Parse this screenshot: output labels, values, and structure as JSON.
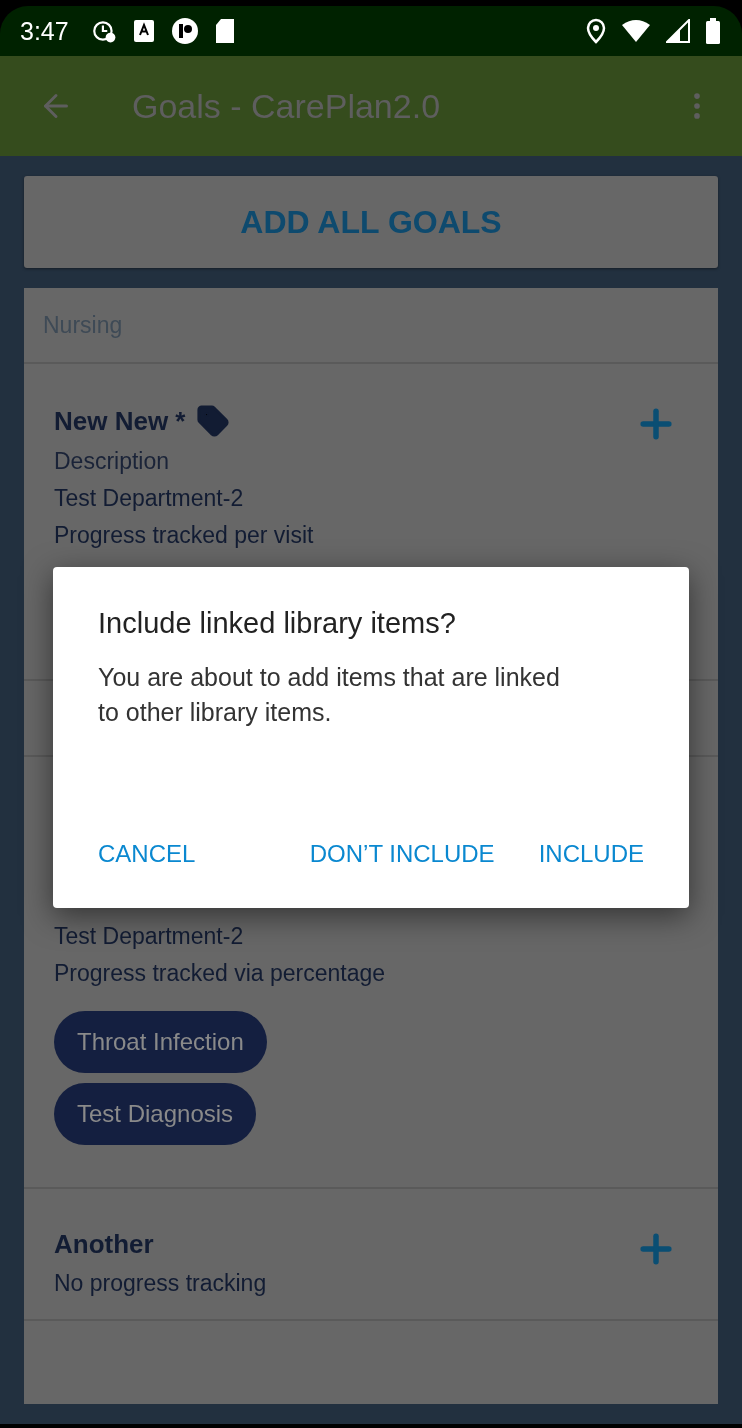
{
  "status_bar": {
    "time": "3:47"
  },
  "app_bar": {
    "title": "Goals - CarePlan2.0"
  },
  "add_all_button": {
    "label": "ADD ALL GOALS"
  },
  "sections": [
    {
      "header": "Nursing",
      "goals": [
        {
          "title": "New New *",
          "tagged": true,
          "can_add": true,
          "lines": [
            {
              "kind": "description",
              "text": "Description"
            },
            {
              "kind": "detail",
              "text": "Test Department-2"
            },
            {
              "kind": "detail",
              "text": "Progress tracked per visit"
            }
          ]
        }
      ]
    },
    {
      "goals": [
        {
          "lines": [
            {
              "kind": "detail",
              "text": "Test Department-2"
            },
            {
              "kind": "detail",
              "text": "Progress tracked via percentage"
            }
          ],
          "chips": [
            "Throat Infection",
            "Test Diagnosis"
          ]
        },
        {
          "title": "Another",
          "tagged": false,
          "can_add": true,
          "lines": [
            {
              "kind": "detail",
              "text": "No progress tracking"
            }
          ]
        }
      ]
    }
  ],
  "dialog": {
    "title": "Include linked library items?",
    "message": "You are about to add items that are linked to other library items.",
    "buttons": [
      "CANCEL",
      "DON’T INCLUDE",
      "INCLUDE"
    ]
  }
}
